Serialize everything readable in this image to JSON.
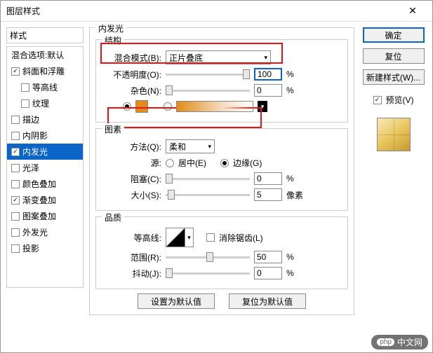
{
  "window": {
    "title": "图层样式"
  },
  "left": {
    "header": "样式",
    "blendOptions": "混合选项:默认",
    "items": [
      {
        "label": "斜面和浮雕",
        "checked": true,
        "indent": false
      },
      {
        "label": "等高线",
        "checked": false,
        "indent": true
      },
      {
        "label": "纹理",
        "checked": false,
        "indent": true
      },
      {
        "label": "描边",
        "checked": false,
        "indent": false
      },
      {
        "label": "内阴影",
        "checked": false,
        "indent": false
      },
      {
        "label": "内发光",
        "checked": true,
        "indent": false,
        "selected": true
      },
      {
        "label": "光泽",
        "checked": false,
        "indent": false
      },
      {
        "label": "颜色叠加",
        "checked": false,
        "indent": false
      },
      {
        "label": "渐变叠加",
        "checked": true,
        "indent": false
      },
      {
        "label": "图案叠加",
        "checked": false,
        "indent": false
      },
      {
        "label": "外发光",
        "checked": false,
        "indent": false
      },
      {
        "label": "投影",
        "checked": false,
        "indent": false
      }
    ]
  },
  "panel": {
    "title": "内发光",
    "structure": {
      "title": "结构",
      "blendModeLabel": "混合模式(B):",
      "blendModeValue": "正片叠底",
      "opacityLabel": "不透明度(O):",
      "opacityValue": "100",
      "opacityUnit": "%",
      "noiseLabel": "杂色(N):",
      "noiseValue": "0",
      "noiseUnit": "%",
      "colorSolid": "#e38c1a"
    },
    "elements": {
      "title": "图素",
      "methodLabel": "方法(Q):",
      "methodValue": "柔和",
      "sourceLabel": "源:",
      "sourceCenter": "居中(E)",
      "sourceEdge": "边缘(G)",
      "chokeLabel": "阻塞(C):",
      "chokeValue": "0",
      "chokeUnit": "%",
      "sizeLabel": "大小(S):",
      "sizeValue": "5",
      "sizeUnit": "像素"
    },
    "quality": {
      "title": "品质",
      "contourLabel": "等高线:",
      "antiAlias": "消除锯齿(L)",
      "rangeLabel": "范围(R):",
      "rangeValue": "50",
      "rangeUnit": "%",
      "jitterLabel": "抖动(J):",
      "jitterValue": "0",
      "jitterUnit": "%"
    },
    "bottom": {
      "makeDefault": "设置为默认值",
      "resetDefault": "复位为默认值"
    }
  },
  "right": {
    "ok": "确定",
    "cancel": "复位",
    "newStyle": "新建样式(W)...",
    "previewLabel": "预览(V)"
  },
  "watermark": {
    "php": "php",
    "text": "中文网"
  }
}
